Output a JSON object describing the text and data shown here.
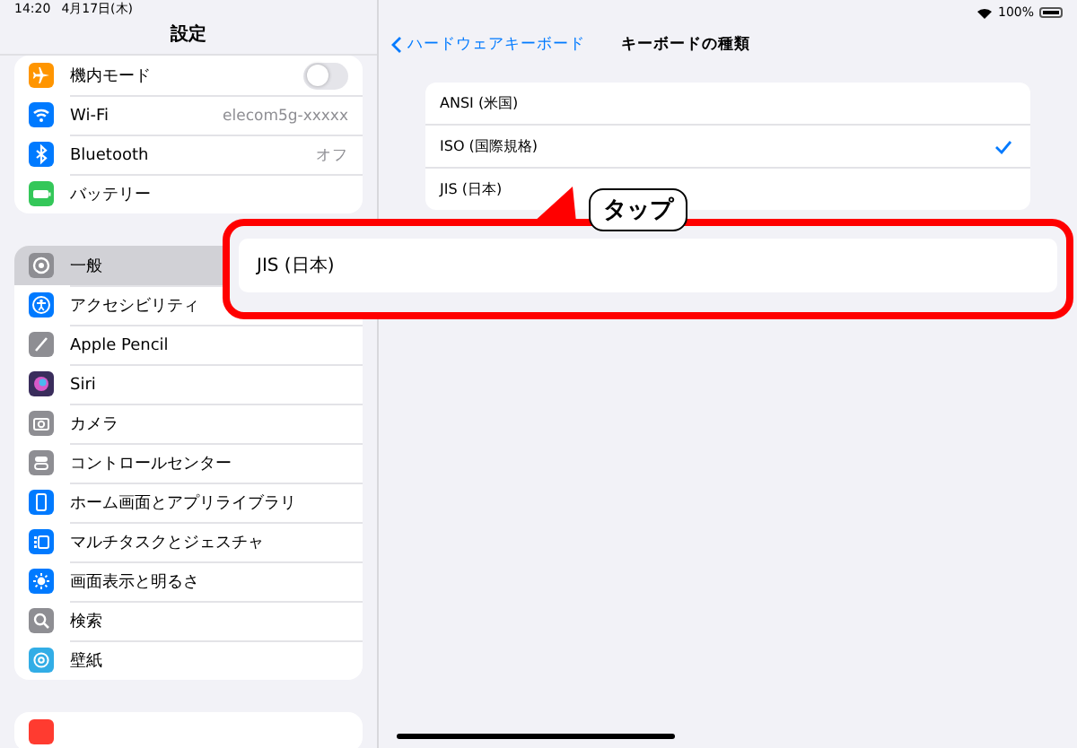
{
  "status_bar": {
    "time": "14:20",
    "date": "4月17日(木)",
    "battery": "100%"
  },
  "sidebar": {
    "title": "設定",
    "groups": [
      {
        "items": [
          {
            "kind": "toggle",
            "label": "機内モード",
            "on": false,
            "selected": false,
            "color": "#ff9500"
          },
          {
            "kind": "value",
            "label": "Wi-Fi",
            "value": "elecom5g-xxxxx",
            "selected": false,
            "color": "#007aff"
          },
          {
            "kind": "value",
            "label": "Bluetooth",
            "value": "オフ",
            "selected": false,
            "color": "#007aff"
          },
          {
            "kind": "plain",
            "label": "バッテリー",
            "selected": false,
            "color": "#34c759"
          }
        ]
      },
      {
        "items": [
          {
            "kind": "plain",
            "label": "一般",
            "selected": true,
            "color": "#8e8e93"
          },
          {
            "kind": "plain",
            "label": "アクセシビリティ",
            "selected": false,
            "color": "#007aff"
          },
          {
            "kind": "plain",
            "label": "Apple Pencil",
            "selected": false,
            "color": "#8e8e93"
          },
          {
            "kind": "plain",
            "label": "Siri",
            "selected": false,
            "color": "#3a2d5c"
          },
          {
            "kind": "plain",
            "label": "カメラ",
            "selected": false,
            "color": "#8e8e93"
          },
          {
            "kind": "plain",
            "label": "コントロールセンター",
            "selected": false,
            "color": "#8e8e93"
          },
          {
            "kind": "plain",
            "label": "ホーム画面とアプリライブラリ",
            "selected": false,
            "color": "#007aff"
          },
          {
            "kind": "plain",
            "label": "マルチタスクとジェスチャ",
            "selected": false,
            "color": "#007aff"
          },
          {
            "kind": "plain",
            "label": "画面表示と明るさ",
            "selected": false,
            "color": "#007aff"
          },
          {
            "kind": "plain",
            "label": "検索",
            "selected": false,
            "color": "#8e8e93"
          },
          {
            "kind": "plain",
            "label": "壁紙",
            "selected": false,
            "color": "#32ade6"
          }
        ]
      },
      {
        "items": [
          {
            "kind": "plain",
            "selected": false,
            "color": "#ff3b30"
          }
        ]
      }
    ]
  },
  "detail": {
    "back": "ハードウェアキーボード",
    "title": "キーボードの種類",
    "options": [
      {
        "label": "ANSI (米国)",
        "selected": false
      },
      {
        "label": "ISO (国際規格)",
        "selected": true
      },
      {
        "label": "JIS (日本)",
        "selected": false
      }
    ]
  },
  "callout": {
    "label": "タップ",
    "zoomed_option": "JIS (日本)"
  }
}
